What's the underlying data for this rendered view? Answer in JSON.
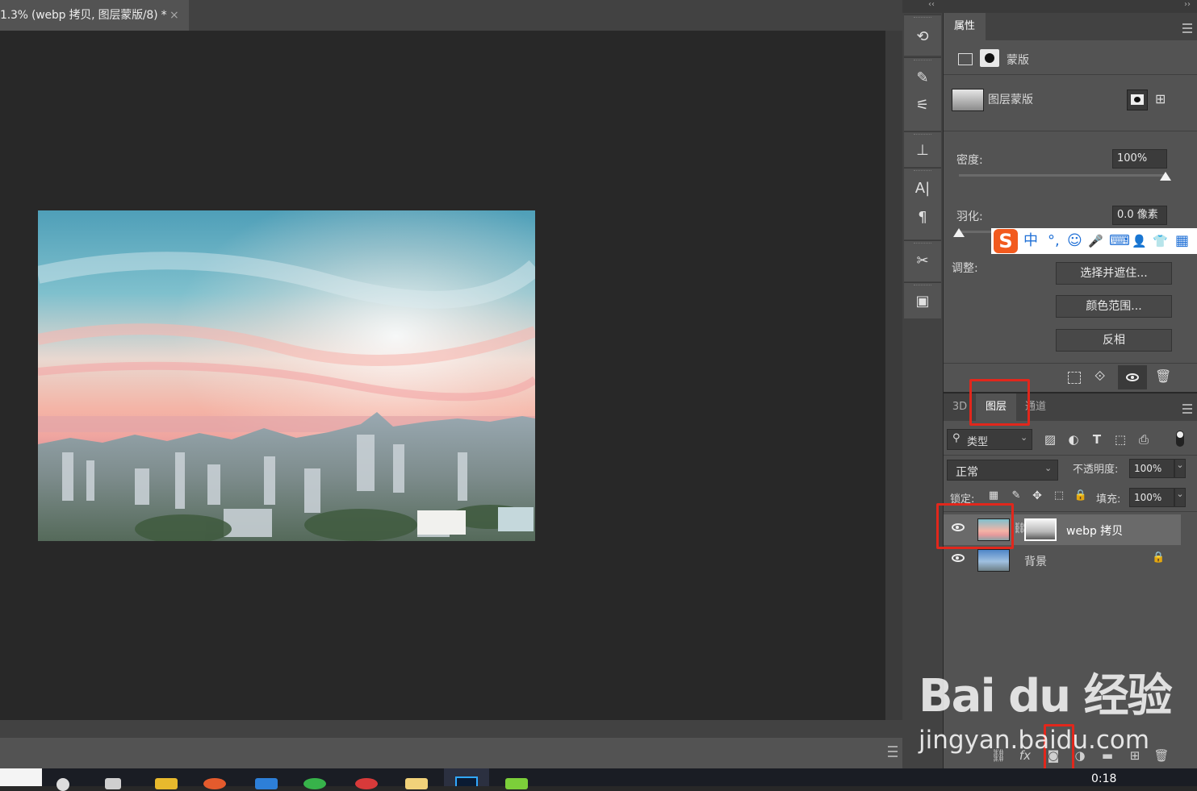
{
  "document": {
    "tab_title": "1.3% (webp 拷贝, 图层蒙版/8) *",
    "close_glyph": "×"
  },
  "collapse": {
    "left": "‹‹",
    "right": "››"
  },
  "properties": {
    "tab_label": "属性",
    "mask_type_label": "蒙版",
    "layer_mask_label": "图层蒙版",
    "density_label": "密度:",
    "density_value": "100%",
    "density_level": 1.0,
    "feather_label": "羽化:",
    "feather_value": "0.0 像素",
    "feather_level": 0.0,
    "adjust_label": "调整:",
    "buttons": {
      "select_mask": "选择并遮住...",
      "color_range": "颜色范围...",
      "invert": "反相"
    }
  },
  "ime_bar": {
    "logo": "S",
    "items": [
      "中",
      "°,",
      "☺",
      "🎤",
      "⌨",
      "👤",
      "👕",
      "▦"
    ]
  },
  "layers_panel": {
    "tabs": [
      "3D",
      "图层",
      "通道"
    ],
    "active_tab": "图层",
    "filter_kind": "类型",
    "blend_mode": "正常",
    "opacity_label": "不透明度:",
    "opacity_value": "100%",
    "lock_label": "锁定:",
    "fill_label": "填充:",
    "fill_value": "100%",
    "layers": [
      {
        "name": "webp 拷贝",
        "selected": true,
        "has_mask": true
      },
      {
        "name": "背景",
        "selected": false,
        "locked": true
      }
    ]
  },
  "bottom_actions": [
    "link-icon",
    "fx-icon",
    "add-mask-icon",
    "adjustment-icon",
    "group-icon",
    "new-layer-icon",
    "trash-icon"
  ],
  "bottom_fx_label": "fx",
  "taskbar": {
    "clock": "0:18"
  },
  "watermark": {
    "logo": "Bai du 经验",
    "url": "jingyan.baidu.com"
  },
  "colors": {
    "highlight": "#e1271c",
    "ime_blue": "#1e6fd6",
    "ime_orange": "#f25a1e"
  }
}
